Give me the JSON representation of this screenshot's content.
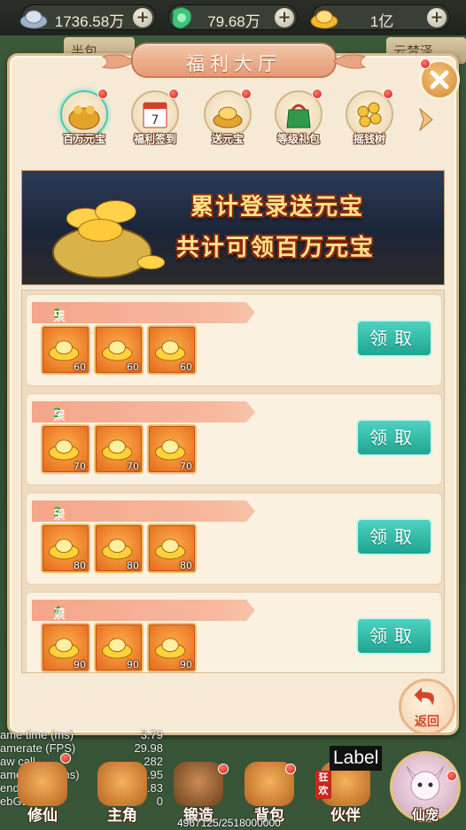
{
  "topbar": {
    "currencies": [
      {
        "icon": "silver-ingot-icon",
        "value": "1736.58万"
      },
      {
        "icon": "jade-icon",
        "value": "79.68万"
      },
      {
        "icon": "gold-ingot-icon",
        "value": "1亿"
      }
    ],
    "plus": "+"
  },
  "background_tabs": [
    "半包",
    "云梦泽"
  ],
  "panel": {
    "title": "福利大厅",
    "nav": [
      {
        "label": "百万元宝",
        "selected": true
      },
      {
        "label": "福利签到",
        "selected": false
      },
      {
        "label": "送元宝",
        "selected": false
      },
      {
        "label": "等级礼包",
        "selected": false
      },
      {
        "label": "摇钱树",
        "selected": false
      }
    ],
    "banner": {
      "line1": "累计登录送元宝",
      "line2": "共计可领百万元宝"
    },
    "rows": [
      {
        "prefix": "累计登录",
        "day": "1",
        "suffix": "天",
        "amounts": [
          "60",
          "60",
          "60"
        ],
        "button": "领取"
      },
      {
        "prefix": "累计登录",
        "day": "2",
        "suffix": "天",
        "amounts": [
          "70",
          "70",
          "70"
        ],
        "button": "领取"
      },
      {
        "prefix": "累计登录",
        "day": "3",
        "suffix": "天",
        "amounts": [
          "80",
          "80",
          "80"
        ],
        "button": "领取"
      },
      {
        "prefix": "累计登录",
        "day": "4",
        "suffix": "天",
        "amounts": [
          "90",
          "90",
          "90"
        ],
        "button": "领取"
      }
    ],
    "back": "返回"
  },
  "stats": [
    {
      "k": "ame time (ms)",
      "v": "3.79"
    },
    {
      "k": "amerate (FPS)",
      "v": "29.98"
    },
    {
      "k": "aw call",
      "v": "282"
    },
    {
      "k": "ame Logic (ms)",
      "v": "0.95"
    },
    {
      "k": "enderer (ms)",
      "v": "2.83"
    },
    {
      "k": "ebGL",
      "v": "0"
    }
  ],
  "bottom_nav": [
    "修仙",
    "主角",
    "锻造",
    "背包",
    "伙伴",
    "仙宠"
  ],
  "debug_label": "Label",
  "memory": "4967125/2518000000",
  "kk_badge": "狂欢",
  "colors": {
    "claim": "#2bb8a4",
    "tag": "#f4a58a",
    "day": "#2fa82f",
    "title": "#e49a77"
  }
}
